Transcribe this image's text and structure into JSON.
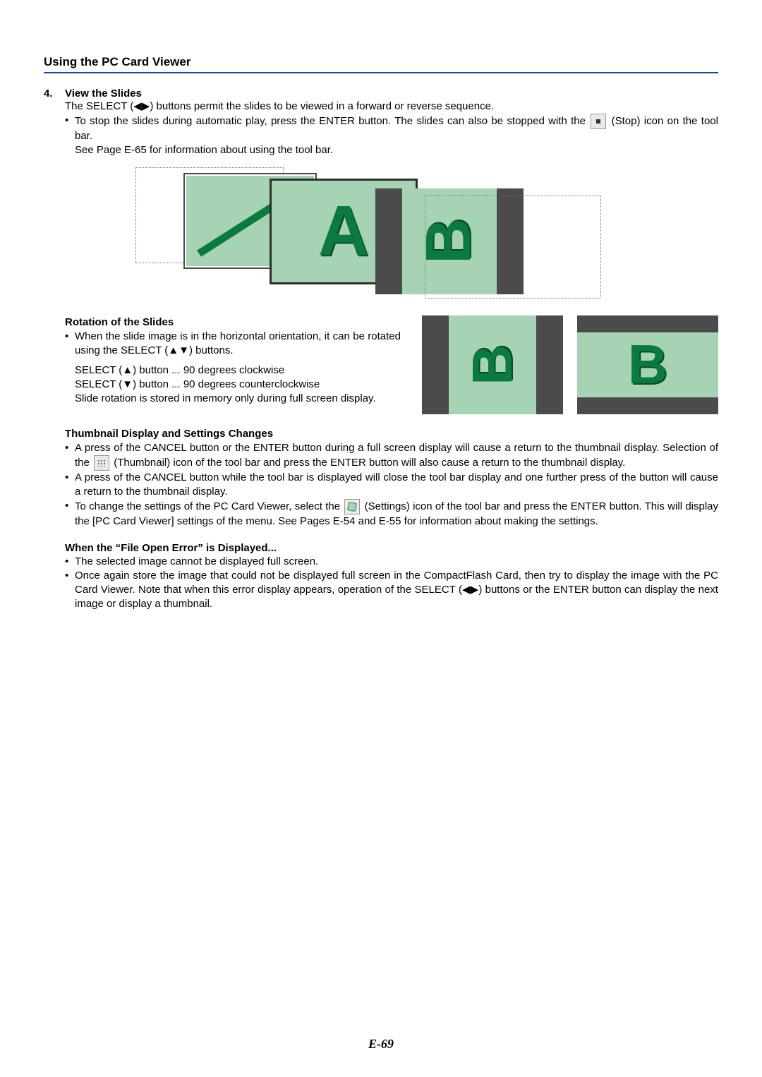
{
  "header": "Using the PC Card Viewer",
  "step4": {
    "num": "4.",
    "title": "View the Slides",
    "line1_a": "The SELECT (",
    "line1_b": ") buttons permit the slides to be viewed in a forward or reverse sequence.",
    "bullet_a": "To stop the slides during automatic play, press the ENTER button. The slides can also be stopped with the ",
    "bullet_b": " (Stop) icon on the tool bar.",
    "line3": "See Page E-65 for information about using the tool bar."
  },
  "rotation": {
    "title": "Rotation of the Slides",
    "bullet_a": "When the slide image is in the horizontal orientation, it can be rotated using the SELECT (",
    "bullet_b": ") buttons.",
    "cw_a": "SELECT (",
    "cw_b": ") button ... 90 degrees clockwise",
    "ccw_a": "SELECT (",
    "ccw_b": ") button ... 90 degrees counterclockwise",
    "note": "Slide rotation is stored in memory only during full screen display."
  },
  "thumb": {
    "title": "Thumbnail Display and Settings Changes",
    "b1": "A press of the CANCEL button or the ENTER button during a full screen display will cause a return to the thumbnail display. Selection of the ",
    "b1b": " (Thumbnail) icon of the tool bar and press the ENTER button will also cause a return to the thumbnail display.",
    "b2": "A press of the CANCEL button while the tool bar is displayed will close the tool bar display and one further press of the button will cause a return to the thumbnail display.",
    "b3a": "To change the settings of the PC Card Viewer, select the ",
    "b3b": " (Settings) icon of the tool bar and press the ENTER button. This will display the [PC Card Viewer] settings of the menu. See Pages E-54 and E-55 for information about making the settings."
  },
  "error": {
    "title": "When the “File Open Error” is Displayed...",
    "b1": "The selected image cannot be displayed full screen.",
    "b2a": "Once again store the image that could not be displayed full screen in the CompactFlash Card, then try to display the image with the PC Card Viewer. Note that when this error display appears, operation of the SELECT (",
    "b2b": ") buttons or the ENTER button can display the next image or display a thumbnail."
  },
  "arrows": {
    "lr": "◀▶",
    "ud": "▲▼",
    "up": "▲",
    "down": "▼"
  },
  "slide_letters": {
    "A": "A",
    "B": "B"
  },
  "footer": "E-69"
}
